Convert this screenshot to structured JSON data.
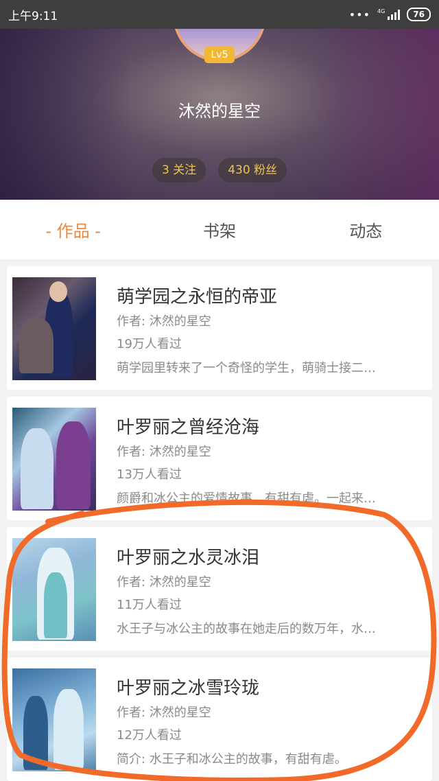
{
  "status_bar": {
    "time": "上午9:11",
    "more": "•••",
    "network": "4G",
    "battery": "76"
  },
  "profile": {
    "level": "Lv5",
    "username": "沐然的星空",
    "following": "3 关注",
    "followers": "430 粉丝"
  },
  "tabs": [
    {
      "label": "- 作品 -",
      "active": true
    },
    {
      "label": "书架",
      "active": false
    },
    {
      "label": "动态",
      "active": false
    }
  ],
  "works": [
    {
      "title": "萌学园之永恒的帝亚",
      "author": "作者: 沐然的星空",
      "views": "19万人看过",
      "desc": "萌学园里转来了一个奇怪的学生，萌骑士接二…"
    },
    {
      "title": "叶罗丽之曾经沧海",
      "author": "作者: 沐然的星空",
      "views": "13万人看过",
      "desc": "颜爵和冰公主的爱情故事，有甜有虐。一起来…"
    },
    {
      "title": "叶罗丽之水灵冰泪",
      "author": "作者: 沐然的星空",
      "views": "11万人看过",
      "desc": "水王子与冰公主的故事在她走后的数万年，水…"
    },
    {
      "title": "叶罗丽之冰雪玲珑",
      "author": "作者: 沐然的星空",
      "views": "12万人看过",
      "desc": "简介: 水王子和冰公主的故事，有甜有虐。"
    }
  ],
  "colors": {
    "accent": "#e8893c",
    "chip_text": "#f0c34a",
    "annotation": "#f26a2a"
  }
}
